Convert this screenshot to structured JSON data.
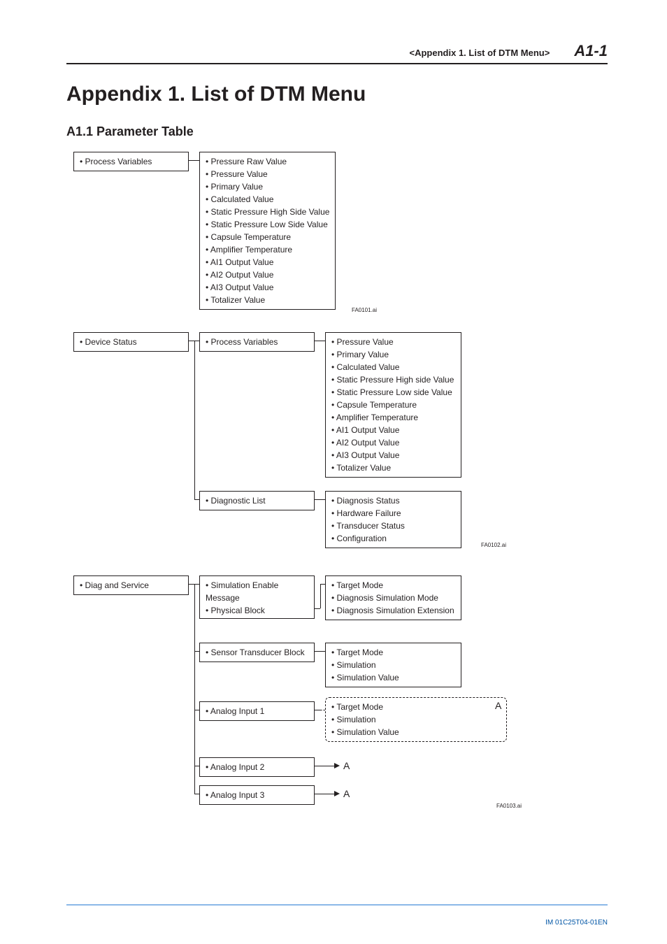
{
  "header": {
    "context": "<Appendix 1.  List of DTM Menu>",
    "page_number": "A1-1"
  },
  "title": "Appendix 1.  List of DTM Menu",
  "section": "A1.1   Parameter Table",
  "fig1": {
    "root": "Process Variables",
    "children": [
      "Pressure Raw Value",
      "Pressure Value",
      "Primary Value",
      "Calculated Value",
      "Static Pressure High Side Value",
      "Static Pressure Low Side Value",
      "Capsule Temperature",
      "Amplifier Temperature",
      "AI1 Output Value",
      "AI2 Output Value",
      "AI3 Output Value",
      "Totalizer Value"
    ],
    "caption": "FA0101.ai"
  },
  "fig2": {
    "root": "Device Status",
    "child1": "Process Variables",
    "child1_items": [
      "Pressure Value",
      "Primary Value",
      "Calculated Value",
      "Static Pressure High side Value",
      "Static Pressure Low side Value",
      "Capsule Temperature",
      "Amplifier Temperature",
      "AI1 Output Value",
      "AI2 Output Value",
      "AI3 Output Value",
      "Totalizer Value"
    ],
    "child2": "Diagnostic List",
    "child2_items": [
      "Diagnosis Status",
      "Hardware Failure",
      "Transducer Status",
      "Configuration"
    ],
    "caption": "FA0102.ai"
  },
  "fig3": {
    "root": "Diag and Service",
    "col2_box1_items": [
      "Simulation Enable Message",
      "Physical Block"
    ],
    "col3_box1_items": [
      "Target Mode",
      "Diagnosis Simulation Mode",
      "Diagnosis Simulation Extension"
    ],
    "col2_box2": "Sensor Transducer Block",
    "col3_box2_items": [
      "Target Mode",
      "Simulation",
      "Simulation Value"
    ],
    "col2_box3": "Analog Input 1",
    "col3_box3_items": [
      "Target Mode",
      "Simulation",
      "Simulation Value"
    ],
    "ref_a1": "A",
    "col2_box4": "Analog Input 2",
    "ref_a2": "A",
    "col2_box5": "Analog Input 3",
    "ref_a3": "A",
    "caption": "FA0103.ai"
  },
  "footer_doc_id": "IM 01C25T04-01EN"
}
